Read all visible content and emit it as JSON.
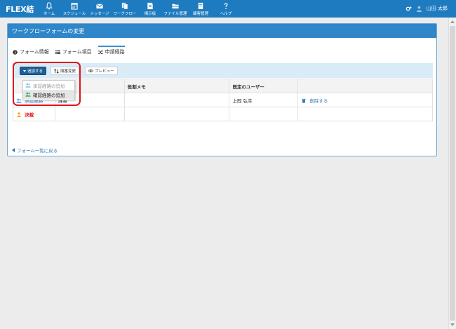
{
  "app": {
    "logo": "FLEX結"
  },
  "nav": [
    {
      "label": "ホーム",
      "icon": "bell-icon"
    },
    {
      "label": "スケジュール",
      "icon": "calendar-icon"
    },
    {
      "label": "メッセージ",
      "icon": "envelope-icon"
    },
    {
      "label": "ワークフロー",
      "icon": "workflow-icon"
    },
    {
      "label": "掲示板",
      "icon": "board-icon"
    },
    {
      "label": "ファイル管理",
      "icon": "folder-icon"
    },
    {
      "label": "顧客管理",
      "icon": "customer-icon"
    },
    {
      "label": "ヘルプ",
      "icon": "help-icon"
    }
  ],
  "user": {
    "name": "山田 太郎",
    "settings_icon": "cogs-icon",
    "avatar_icon": "user-icon"
  },
  "panel": {
    "title": "ワークフローフォームの変更"
  },
  "tabs": [
    {
      "label": "フォーム情報",
      "icon": "info-icon",
      "active": false
    },
    {
      "label": "フォーム項目",
      "icon": "list-icon",
      "active": false
    },
    {
      "label": "申請経路",
      "icon": "shuffle-icon",
      "active": true
    }
  ],
  "toolbar": {
    "add_label": "追加する",
    "order_label": "順番変更",
    "preview_label": "プレビュー"
  },
  "table": {
    "headers": [
      "",
      "役割",
      "役割メモ",
      "既定のユーザー",
      ""
    ],
    "rows": [
      {
        "type": "承認経路",
        "role": "課長",
        "memo": "",
        "user": "上間 弘幸",
        "action": "削除する"
      },
      {
        "type": "決裁",
        "role": "",
        "memo": "",
        "user": "",
        "action": ""
      }
    ]
  },
  "dropdown": {
    "items": [
      {
        "label": "承認経路の追加",
        "disabled": true
      },
      {
        "label": "確認経路の追加",
        "disabled": false,
        "selected": true
      }
    ]
  },
  "back_link": "フォーム一覧に戻る",
  "colors": {
    "topbar": "#1f7bbf",
    "panel_header": "#2f86c8",
    "highlight": "#e3101b",
    "decision": "#e0141a"
  }
}
